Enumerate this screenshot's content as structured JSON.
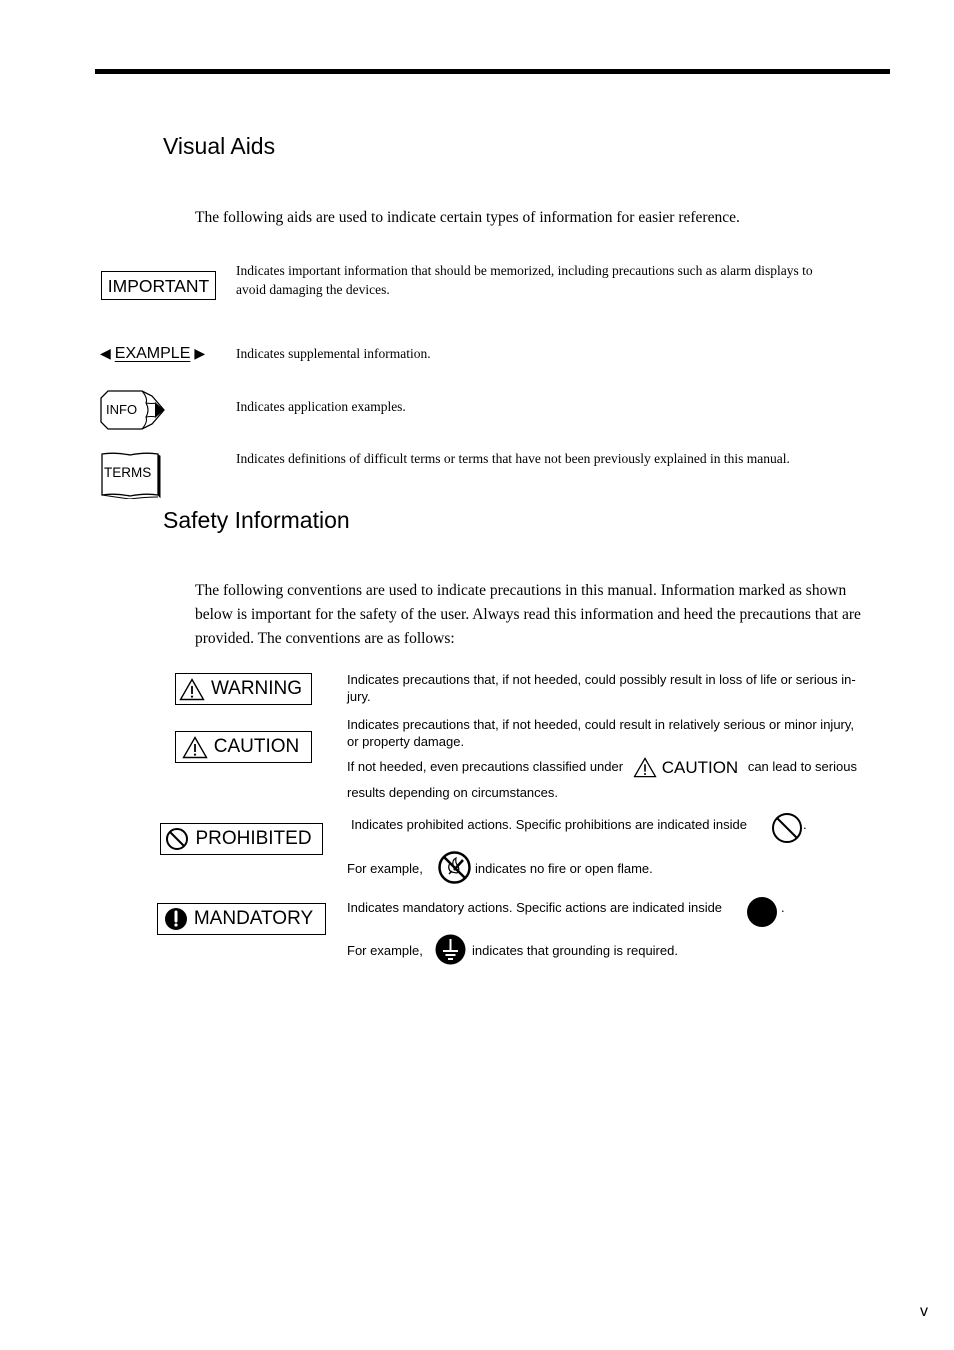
{
  "visual_aids": {
    "title": "Visual Aids",
    "intro": "The following aids are used to indicate certain types of information for easier reference.",
    "items": [
      {
        "icon": "important-box",
        "label": "IMPORTANT",
        "description_line1": "Indicates important information that should be memorized, including precautions such as alarm displays to",
        "description_line2": "avoid damaging the devices."
      },
      {
        "icon": "example-arrows",
        "label": "EXAMPLE",
        "description": "Indicates supplemental information."
      },
      {
        "icon": "info-pencil",
        "label": "INFO",
        "description": "Indicates application examples."
      },
      {
        "icon": "terms-book",
        "label": "TERMS",
        "description": "Indicates definitions of difficult terms or terms that have not been previously explained in this manual."
      }
    ]
  },
  "safety": {
    "title": "Safety Information",
    "intro_line1": "The following conventions are used to indicate precautions in this manual. Information marked as shown",
    "intro_line2": "below is important for the safety of the user. Always read this information and heed the precautions that are",
    "intro_line3": "provided. The conventions are as follows:",
    "warning": {
      "label": "WARNING",
      "desc_line1": "Indicates precautions that, if not heeded, could possibly result in loss of life or serious in-",
      "desc_line2": "jury."
    },
    "caution": {
      "label": "CAUTION",
      "desc_line1": "Indicates precautions that, if not heeded, could result in relatively serious or minor injury,",
      "desc_line2": "or property damage.",
      "note_before": "If not heeded, even precautions classified under",
      "note_label": "CAUTION",
      "note_after": "can lead to serious",
      "note_line2": "results depending on circumstances."
    },
    "prohibited": {
      "label": "PROHIBITED",
      "desc": "Indicates prohibited actions. Specific prohibitions are indicated inside",
      "desc_end": ".",
      "example_before": "For example,",
      "example_after": "indicates no fire or open flame."
    },
    "mandatory": {
      "label": "MANDATORY",
      "desc": "Indicates mandatory actions. Specific actions are indicated inside",
      "desc_end": ".",
      "example_before": "For example,",
      "example_after": "indicates that grounding is required."
    }
  },
  "page_number": "v"
}
